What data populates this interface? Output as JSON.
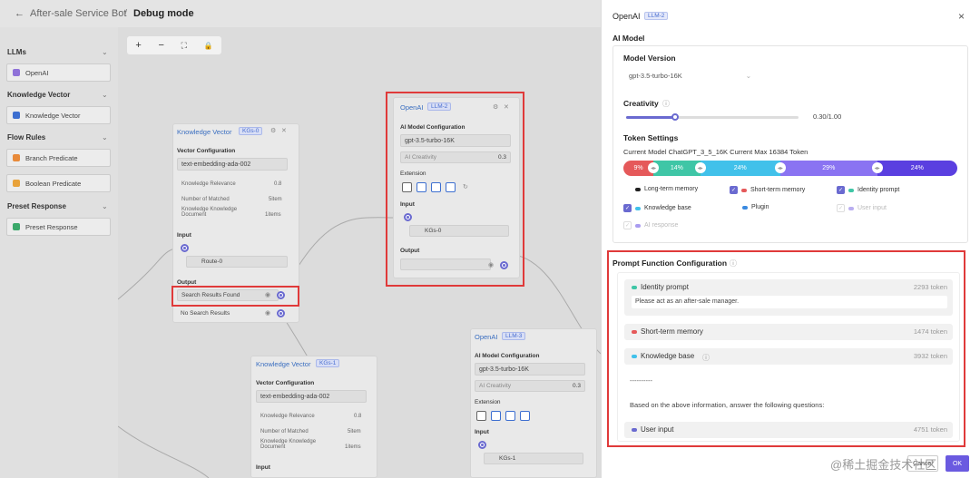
{
  "header": {
    "back_icon": "←",
    "crumb_parent": "After-sale Service Bot",
    "separator": "/",
    "crumb_current": "Debug mode"
  },
  "sidebar": {
    "sections": [
      {
        "title": "LLMs",
        "items": [
          {
            "label": "OpenAI",
            "color": "#8f72d8"
          }
        ]
      },
      {
        "title": "Knowledge Vector",
        "items": [
          {
            "label": "Knowledge Vector",
            "color": "#3d6fd0"
          }
        ]
      },
      {
        "title": "Flow Rules",
        "items": [
          {
            "label": "Branch Predicate",
            "color": "#e88a3a"
          },
          {
            "label": "Boolean Predicate",
            "color": "#e8a23a"
          }
        ]
      },
      {
        "title": "Preset Response",
        "items": [
          {
            "label": "Preset Response",
            "color": "#3aa86a"
          }
        ]
      }
    ]
  },
  "toolbar": {
    "zoom_in": "+",
    "zoom_out": "−",
    "fit": "⛶",
    "lock": "🔒"
  },
  "nodes": {
    "kv1": {
      "title": "Knowledge Vector",
      "tag": "KGs-0",
      "vector_config": "Vector Configuration",
      "model": "text-embedding-ada-002",
      "rows": [
        {
          "k": "Knowledge Relevance",
          "v": "0.8"
        },
        {
          "k": "Number of Matched",
          "v": "5item"
        },
        {
          "k": "Knowledge Knowledge Document",
          "v": "1items"
        }
      ],
      "input": "Input",
      "input_val": "Route-0",
      "output": "Output",
      "out1": "Search Results Found",
      "out2": "No Search Results"
    },
    "llm2": {
      "title": "OpenAI",
      "tag": "LLM-2",
      "config": "AI Model Configuration",
      "model": "gpt-3.5-turbo-16K",
      "creativity": "AI Creativity",
      "creativity_val": "0.3",
      "extension": "Extension",
      "input": "Input",
      "input_val": "KGs-0",
      "output": "Output"
    },
    "llm3": {
      "title": "OpenAI",
      "tag": "LLM-3",
      "config": "AI Model Configuration",
      "model": "gpt-3.5-turbo-16K",
      "creativity": "AI Creativity",
      "creativity_val": "0.3",
      "extension": "Extension",
      "input": "Input",
      "input_val": "KGs-1"
    },
    "kv2": {
      "title": "Knowledge Vector",
      "tag": "KGs-1",
      "vector_config": "Vector Configuration",
      "model": "text-embedding-ada-002",
      "rows": [
        {
          "k": "Knowledge Relevance",
          "v": "0.8"
        },
        {
          "k": "Number of Matched",
          "v": "5item"
        },
        {
          "k": "Knowledge Knowledge Document",
          "v": "1items"
        }
      ],
      "input": "Input"
    }
  },
  "panel": {
    "title": "OpenAI",
    "tag": "LLM-2",
    "close": "×",
    "ai_model": "AI Model",
    "model_version_label": "Model Version",
    "model_version": "gpt-3.5-turbo-16K",
    "creativity_label": "Creativity",
    "creativity_value": "0.30/1.00",
    "creativity_fraction": 0.3,
    "token_settings": "Token Settings",
    "token_info": "Current Model ChatGPT_3_5_16K Current Max 16384 Token",
    "token_bar": [
      {
        "label": "9%",
        "pct": 9,
        "color": "#e5595a"
      },
      {
        "label": "14%",
        "pct": 14,
        "color": "#3fc6a6"
      },
      {
        "label": "24%",
        "pct": 24,
        "color": "#41c1ea"
      },
      {
        "label": "29%",
        "pct": 29,
        "color": "#8a73f2"
      },
      {
        "label": "24%",
        "pct": 24,
        "color": "#5a3fe0"
      }
    ],
    "legend": [
      {
        "label": "Long-term memory",
        "checked": false,
        "dot": "#222"
      },
      {
        "label": "Short-term memory",
        "checked": true,
        "dot": "#e5595a"
      },
      {
        "label": "Identity prompt",
        "checked": true,
        "dot": "#3fc6a6"
      },
      {
        "label": "Knowledge base",
        "checked": true,
        "dot": "#41c1ea"
      },
      {
        "label": "Plugin",
        "checked": false,
        "dot": "#3a8ae0"
      },
      {
        "label": "User input",
        "checked": true,
        "dot": "#8a73f2",
        "disabled": true
      },
      {
        "label": "AI response",
        "checked": true,
        "dot": "#5a3fe0",
        "disabled": true
      }
    ],
    "pfc_title": "Prompt Function Configuration",
    "identity": {
      "label": "Identity prompt",
      "tokens": "2293 token",
      "text": "Please act as an after-sale manager."
    },
    "short_term": {
      "label": "Short-term memory",
      "tokens": "1474 token"
    },
    "knowledge": {
      "label": "Knowledge base",
      "tokens": "3932 token"
    },
    "divider": "----------",
    "based_on": "Based on the above information, answer the following questions:",
    "user_input": {
      "label": "User input",
      "tokens": "4751 token"
    },
    "cancel": "Cancel",
    "ok": "OK"
  },
  "watermark": "@稀土掘金技术社区"
}
